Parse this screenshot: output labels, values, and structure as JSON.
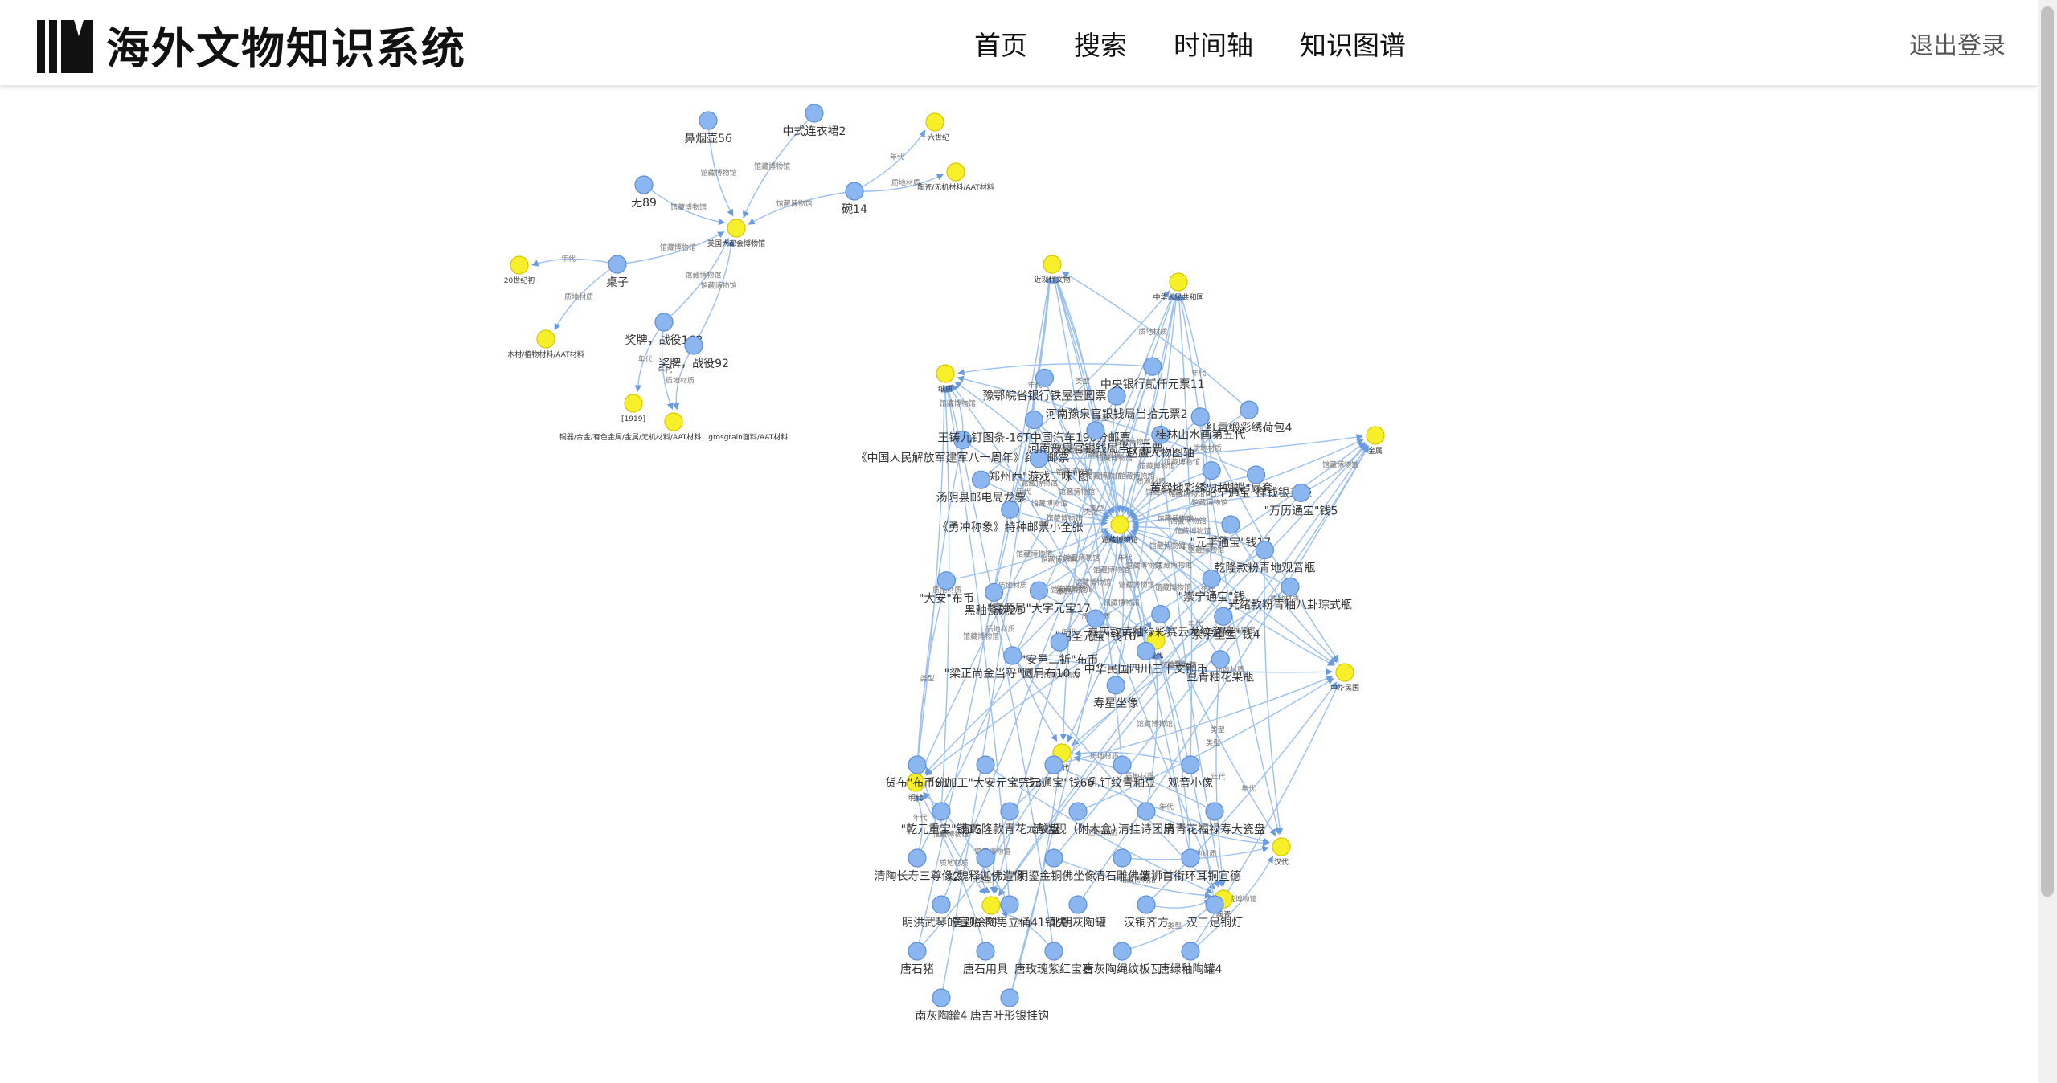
{
  "header": {
    "site_title": "海外文物知识系统",
    "nav": [
      {
        "label": "首页"
      },
      {
        "label": "搜索"
      },
      {
        "label": "时间轴"
      },
      {
        "label": "知识图谱"
      }
    ],
    "logout_label": "退出登录"
  },
  "colors": {
    "entity_node": "#8bb6f0",
    "attribute_node": "#f7ef2a",
    "edge": "#9cc0ee"
  },
  "graph": {
    "edge_labels": [
      "年代",
      "类型",
      "馆藏博物馆",
      "质地材质"
    ],
    "clusters": [
      {
        "hub": "美国大都会博物馆",
        "nodes": [
          {
            "label": "鼻烟壶56",
            "kind": "entity"
          },
          {
            "label": "中式连衣裙2",
            "kind": "entity"
          },
          {
            "label": "无89",
            "kind": "entity"
          },
          {
            "label": "碗14",
            "kind": "entity"
          },
          {
            "label": "桌子",
            "kind": "entity"
          },
          {
            "label": "奖牌，战役162",
            "kind": "entity"
          },
          {
            "label": "奖牌，战役92",
            "kind": "entity"
          },
          {
            "label": "十六世纪",
            "kind": "attribute"
          },
          {
            "label": "陶瓷/无机材料/AAT材料",
            "kind": "attribute"
          },
          {
            "label": "20世纪初",
            "kind": "attribute"
          },
          {
            "label": "木材/植物材料/AAT材料",
            "kind": "attribute"
          },
          {
            "label": "[1919]",
            "kind": "attribute"
          },
          {
            "label": "铜器/合金/有色金属/金属/无机材料/AAT材料；grosgrain面料/AAT材料",
            "kind": "attribute"
          }
        ]
      },
      {
        "hub": "馆藏博物馆",
        "nodes": [
          {
            "label": "近现代文物",
            "kind": "attribute"
          },
          {
            "label": "中华人民共和国",
            "kind": "attribute"
          },
          {
            "label": "纸质",
            "kind": "attribute"
          },
          {
            "label": "金属",
            "kind": "attribute"
          },
          {
            "label": "中华民国",
            "kind": "attribute"
          },
          {
            "label": "宋代",
            "kind": "attribute"
          },
          {
            "label": "清代",
            "kind": "attribute"
          },
          {
            "label": "明代",
            "kind": "attribute"
          },
          {
            "label": "唐代",
            "kind": "attribute"
          },
          {
            "label": "陶瓷",
            "kind": "attribute"
          },
          {
            "label": "汉代",
            "kind": "attribute"
          },
          {
            "label": "《勇冲称象》特种邮票小全张",
            "kind": "entity"
          },
          {
            "label": "汤阴县邮电局龙票",
            "kind": "entity"
          },
          {
            "label": "《中国人民解放军建军八十周年》纪念邮票",
            "kind": "entity"
          },
          {
            "label": "郑州西\"游戏三味\"图",
            "kind": "entity"
          },
          {
            "label": "王铸九钉图条-16T中国汽车190分邮票",
            "kind": "entity"
          },
          {
            "label": "豫鄂皖省银行铁屋壹圆票",
            "kind": "entity"
          },
          {
            "label": "河南豫泉官银钱局当十元票",
            "kind": "entity"
          },
          {
            "label": "河南豫泉官银钱局当拾元票2",
            "kind": "entity"
          },
          {
            "label": "中央银行贰仟元票11",
            "kind": "entity"
          },
          {
            "label": "赵盧人物图轴",
            "kind": "entity"
          },
          {
            "label": "桂林山水画第五代",
            "kind": "entity"
          },
          {
            "label": "红青缎彩绣荷包4",
            "kind": "entity"
          },
          {
            "label": "黄缎地彩绣\"对蝴蝶\"扇套",
            "kind": "entity"
          },
          {
            "label": "\"昭宁通宝\"样钱银五钱",
            "kind": "entity"
          },
          {
            "label": "\"万历通宝\"钱5",
            "kind": "entity"
          },
          {
            "label": "\"元丰通宝\"钱17",
            "kind": "entity"
          },
          {
            "label": "乾隆款粉青地观音瓶",
            "kind": "entity"
          },
          {
            "label": "光绪款粉青釉八卦琮式瓶",
            "kind": "entity"
          },
          {
            "label": "\"崇宁通宝\"钱",
            "kind": "entity"
          },
          {
            "label": "\"崇宁重宝\"钱4",
            "kind": "entity"
          },
          {
            "label": "豆青釉花果瓶",
            "kind": "entity"
          },
          {
            "label": "嘉庆款黄釉绿彩赛云龙纹瓷碗",
            "kind": "entity"
          },
          {
            "label": "中华民国四川三十文铜币",
            "kind": "entity"
          },
          {
            "label": "寿星坐像",
            "kind": "entity"
          },
          {
            "label": "\"绍圣元宝\"钱16",
            "kind": "entity"
          },
          {
            "label": "\"安邑二釿\"布币",
            "kind": "entity"
          },
          {
            "label": "\"梁正尚金当寽\"圆肩布10.6",
            "kind": "entity"
          },
          {
            "label": "\"宝源局\"大字元宝17",
            "kind": "entity"
          },
          {
            "label": "黑釉瓷碗25",
            "kind": "entity"
          },
          {
            "label": "\"大安\"布币",
            "kind": "entity"
          },
          {
            "label": "货布\"布币81",
            "kind": "entity"
          },
          {
            "label": "\"分加工\"大安元宝\"钱3",
            "kind": "entity"
          },
          {
            "label": "\"开元通宝\"钱66",
            "kind": "entity"
          },
          {
            "label": "乳钉纹青釉豆",
            "kind": "entity"
          },
          {
            "label": "观音小像",
            "kind": "entity"
          },
          {
            "label": "\"乾元重宝\"钱15",
            "kind": "entity"
          },
          {
            "label": "清乾隆款青花龙纹盘",
            "kind": "entity"
          },
          {
            "label": "清端砚（附木盒）",
            "kind": "entity"
          },
          {
            "label": "清挂诗团扇",
            "kind": "entity"
          },
          {
            "label": "清青花福禄寿大瓷盘",
            "kind": "entity"
          },
          {
            "label": "清陶长寿三尊像2",
            "kind": "entity"
          },
          {
            "label": "北魏释迦佛造像",
            "kind": "entity"
          },
          {
            "label": "\"明鎏金铜佛坐像",
            "kind": "entity"
          },
          {
            "label": "清石雕佛像",
            "kind": "entity"
          },
          {
            "label": "清狮首衔环耳铜宣德",
            "kind": "entity"
          },
          {
            "label": "明洪武琴的宣贴",
            "kind": "entity"
          },
          {
            "label": "唐彩绘陶男立俑41镇失",
            "kind": "entity"
          },
          {
            "label": "北朝灰陶罐",
            "kind": "entity"
          },
          {
            "label": "汉铜齐方",
            "kind": "entity"
          },
          {
            "label": "汉三足铜灯",
            "kind": "entity"
          },
          {
            "label": "唐石猪",
            "kind": "entity"
          },
          {
            "label": "唐石用具",
            "kind": "entity"
          },
          {
            "label": "唐玫瑰紫红宝石",
            "kind": "entity"
          },
          {
            "label": "唐灰陶绳纹板瓦",
            "kind": "entity"
          },
          {
            "label": "唐绿釉陶罐4",
            "kind": "entity"
          },
          {
            "label": "南灰陶罐4",
            "kind": "entity"
          },
          {
            "label": "唐吉叶形银挂钩",
            "kind": "entity"
          }
        ]
      }
    ]
  }
}
